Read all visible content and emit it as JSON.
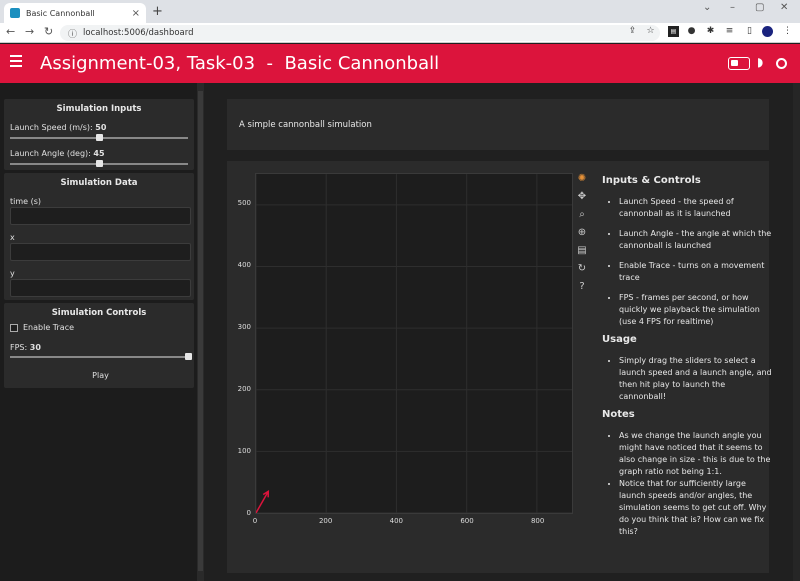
{
  "browser": {
    "tab_title": "Basic Cannonball",
    "tab_close": "×",
    "new_tab": "+",
    "url": "localhost:5006/dashboard"
  },
  "header": {
    "title": "Assignment-03, Task-03  -  Basic Cannonball"
  },
  "sidebar": {
    "inputs": {
      "title": "Simulation Inputs",
      "speed_label": "Launch Speed (m/s): ",
      "speed_value": "50",
      "speed_fraction": 0.5,
      "angle_label": "Launch Angle (deg): ",
      "angle_value": "45",
      "angle_fraction": 0.5
    },
    "data": {
      "title": "Simulation Data",
      "time_label": "time (s)",
      "x_label": "x",
      "y_label": "y"
    },
    "controls": {
      "title": "Simulation Controls",
      "trace_label": "Enable Trace",
      "fps_label": "FPS: ",
      "fps_value": "30",
      "fps_fraction": 1.0,
      "play_label": "Play"
    }
  },
  "main": {
    "description": "A simple cannonball simulation"
  },
  "chart_data": {
    "type": "scatter",
    "title": "",
    "xlabel": "",
    "ylabel": "",
    "xlim": [
      0,
      900
    ],
    "ylim": [
      0,
      550
    ],
    "x_ticks": [
      "0",
      "200",
      "400",
      "600",
      "800"
    ],
    "y_ticks": [
      "0",
      "100",
      "200",
      "300",
      "400",
      "500"
    ],
    "grid": true,
    "arrow": {
      "x0": 0,
      "y0": 0,
      "x1": 35,
      "y1": 35,
      "color": "#dc143c"
    }
  },
  "docs": {
    "h_inputs": "Inputs & Controls",
    "inputs_items": [
      "Launch Speed - the speed of cannonball as it is launched",
      "Launch Angle - the angle at which the cannonball is launched",
      "Enable Trace - turns on a movement trace",
      "FPS - frames per second, or how quickly we playback the simulation (use 4 FPS for realtime)"
    ],
    "h_usage": "Usage",
    "usage_items": [
      "Simply drag the sliders to select a launch speed and a launch angle, and then hit play to launch the cannonball!"
    ],
    "h_notes": "Notes",
    "notes_items": [
      "As we change the launch angle you might have noticed that it seems to also change in size - this is due to the graph ratio not being 1:1.",
      "Notice that for sufficiently large launch speeds and/or angles, the simulation seems to get cut off. Why do you think that is? How can we fix this?"
    ]
  },
  "colors": {
    "accent": "#dc143c",
    "panel": "#2b2b2b",
    "background": "#202020"
  }
}
